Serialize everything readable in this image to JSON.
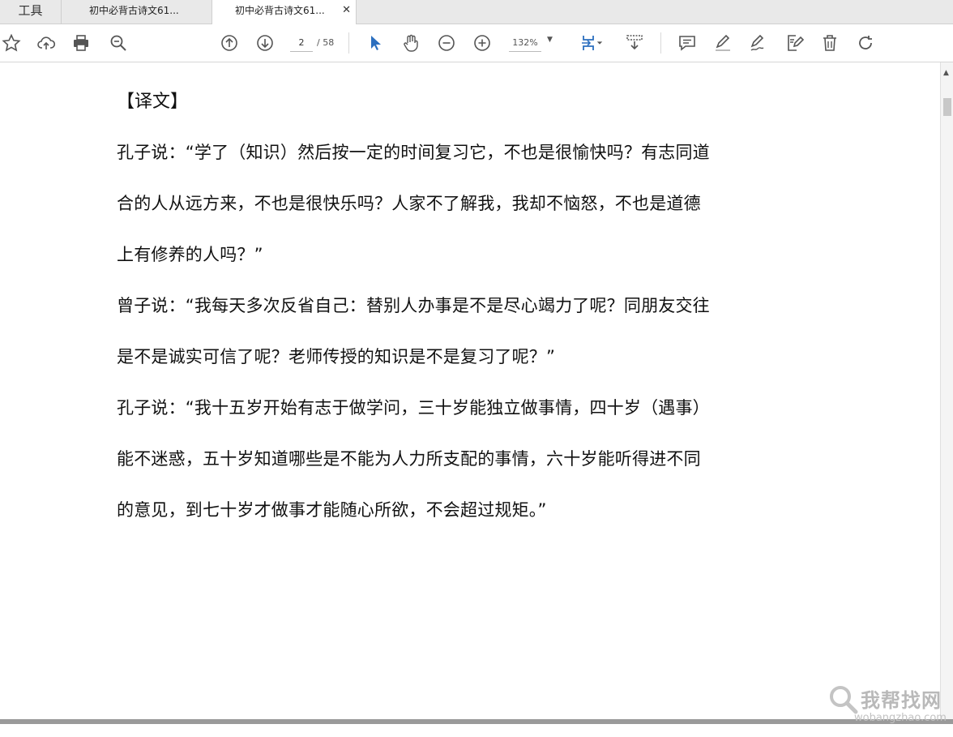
{
  "tabs": {
    "tools": "工具",
    "doc1": "初中必背古诗文61...",
    "doc2": "初中必背古诗文61...",
    "close": "✕"
  },
  "toolbar": {
    "page_current": "2",
    "page_total": "/ 58",
    "zoom": "132%",
    "icons": [
      "star-icon",
      "cloud-upload-icon",
      "print-icon",
      "zoom-search-icon",
      "page-up-icon",
      "page-down-icon",
      "select-cursor-icon",
      "hand-icon",
      "zoom-out-icon",
      "zoom-in-icon",
      "fit-page-icon",
      "scroll-mode-icon",
      "comment-icon",
      "highlight-icon",
      "sign-icon",
      "edit-icon",
      "delete-icon",
      "rotate-icon"
    ],
    "accent": "#2b6fbf"
  },
  "document": {
    "heading": "【译文】",
    "lines": [
      "孔子说：“学了（知识）然后按一定的时间复习它，不也是很愉快吗？有志同道",
      "合的人从远方来，不也是很快乐吗？人家不了解我，我却不恼怒，不也是道德",
      "上有修养的人吗？”",
      "曾子说：“我每天多次反省自己：替别人办事是不是尽心竭力了呢？同朋友交往",
      "是不是诚实可信了呢？老师传授的知识是不是复习了呢？”",
      "孔子说：“我十五岁开始有志于做学问，三十岁能独立做事情，四十岁（遇事）",
      "能不迷惑，五十岁知道哪些是不能为人力所支配的事情，六十岁能听得进不同",
      "的意见，到七十岁才做事才能随心所欲，不会超过规矩。”"
    ]
  },
  "watermark": {
    "cn": "我帮找网",
    "url": "wobangzhao.com"
  }
}
